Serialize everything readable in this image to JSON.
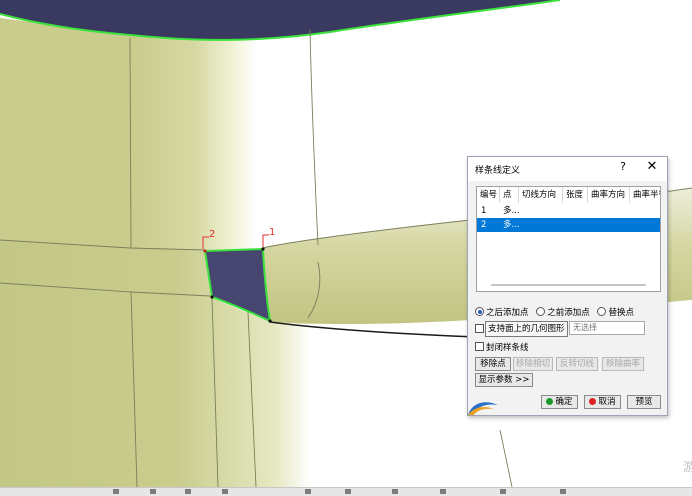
{
  "dialog": {
    "title": "样条线定义",
    "help_label": "?",
    "close_label": "✕",
    "table": {
      "columns": [
        "编号",
        "点",
        "切线方向",
        "张度",
        "曲率方向",
        "曲率半径"
      ],
      "rows": [
        {
          "index": "1",
          "point": "多...",
          "selected": false
        },
        {
          "index": "2",
          "point": "多...",
          "selected": true
        }
      ]
    },
    "insert_mode": {
      "options": [
        "之后添加点",
        "之前添加点",
        "替换点"
      ],
      "selected": "之后添加点"
    },
    "support": {
      "label": "支持面上的几何图形",
      "placeholder": "无选择",
      "checked": false
    },
    "closed_spline": {
      "label": "封闭样条线",
      "checked": false
    },
    "actions": [
      {
        "label": "移除点",
        "enabled": true
      },
      {
        "label": "移除相切",
        "enabled": false
      },
      {
        "label": "反转切线",
        "enabled": false
      },
      {
        "label": "移除曲率",
        "enabled": false
      }
    ],
    "show_params_label": "显示参数 >>",
    "ok_label": "确定",
    "cancel_label": "取消",
    "preview_label": "预览"
  },
  "viewport": {
    "point_labels": [
      "2",
      "1"
    ],
    "colors": {
      "surface": "#c9cc8c",
      "surface_highlight": "#fdfdf0",
      "edge": "#7c7e5c",
      "selected_edge": "#3ce23c",
      "patch": "#474670",
      "dark_surface": "#3a3960",
      "point_label": "#e23030"
    }
  },
  "watermark": "游"
}
